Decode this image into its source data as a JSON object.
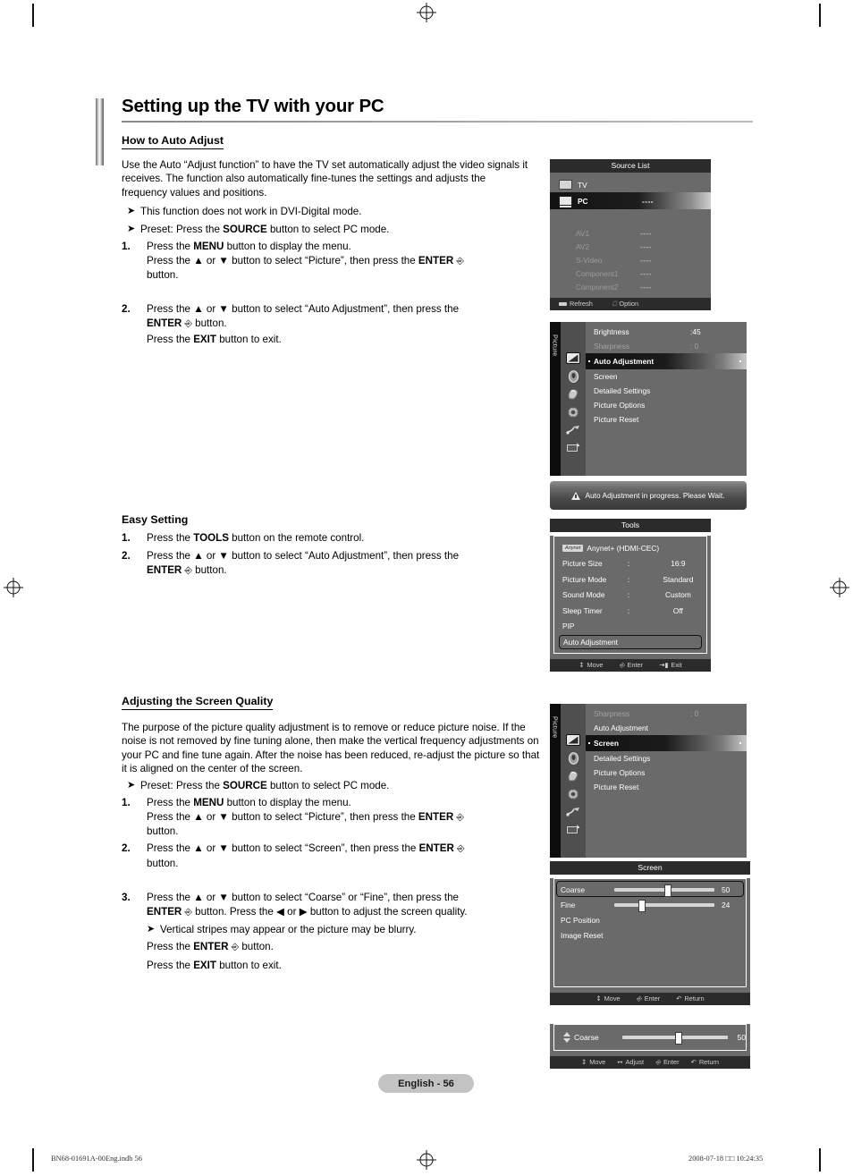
{
  "page": {
    "title": "Setting up the TV with your PC",
    "language_badge": "English - 56",
    "footer_left": "BN68-01691A-00Eng.indb   56",
    "footer_right": "2008-07-18   □□ 10:24:35"
  },
  "section_auto_adjust": {
    "heading": "How to Auto Adjust",
    "intro": "Use the Auto “Adjust function” to have the TV set automatically adjust the video signals it receives. The function also automatically fine-tunes the settings and adjusts the frequency values and positions.",
    "bullets": [
      "This function does not work in DVI-Digital mode.",
      "Preset: Press the SOURCE button to select PC mode."
    ],
    "steps": [
      {
        "num": "1.",
        "line1": "Press the MENU button to display the menu.",
        "line2": "Press the ▲ or ▼ button to select “Picture”, then press the ENTER",
        "line3": "button."
      },
      {
        "num": "2.",
        "line1": "Press the ▲ or ▼ button to select “Auto Adjustment”, then press the",
        "line2": "ENTER",
        "line3": "button.",
        "line4": "Press the EXIT button to exit."
      }
    ]
  },
  "section_easy_setting": {
    "heading": "Easy Setting",
    "steps": [
      {
        "num": "1.",
        "line1": "Press the TOOLS button on the remote control."
      },
      {
        "num": "2.",
        "line1": "Press the ▲ or ▼ button to select “Auto Adjustment”, then press the",
        "line2": "ENTER",
        "line3": "button."
      }
    ]
  },
  "section_screen_quality": {
    "heading": "Adjusting the Screen Quality",
    "intro": "The purpose of the picture quality adjustment is to remove or reduce picture noise. If the noise is not removed by fine tuning alone, then make the vertical frequency adjustments on your PC and fine tune again. After the noise has been reduced, re-adjust the picture so that it is aligned on the center of the screen.",
    "bullets": [
      "Preset: Press the SOURCE button to select PC mode."
    ],
    "steps": [
      {
        "num": "1.",
        "line1": "Press the MENU button to display the menu.",
        "line2": "Press the ▲ or ▼ button to select “Picture”, then press the ENTER",
        "line3": "button."
      },
      {
        "num": "2.",
        "line1": "Press the ▲ or ▼ button to select “Screen”, then press the ENTER",
        "line3": "button."
      },
      {
        "num": "3.",
        "line1": "Press the ▲ or ▼ button to select “Coarse” or “Fine”, then press the",
        "line2": "ENTER",
        "line2b": "button. Press the ◀ or ▶ button to adjust the screen quality.",
        "sub": "Vertical stripes may appear or the picture may be blurry.",
        "line3": "Press the ENTER",
        "line3b": "button.",
        "line4": "Press the EXIT button to exit."
      }
    ]
  },
  "osd_source_list": {
    "title": "Source List",
    "rows": [
      {
        "icon": "tv-icon",
        "name": "TV",
        "value": "",
        "state": "normal"
      },
      {
        "icon": "pc-icon",
        "name": "PC",
        "value": "----",
        "state": "selected"
      },
      {
        "icon": "",
        "name": "AV1",
        "value": "----",
        "state": "dim"
      },
      {
        "icon": "",
        "name": "AV2",
        "value": "----",
        "state": "dim"
      },
      {
        "icon": "",
        "name": "S-Video",
        "value": "----",
        "state": "dim"
      },
      {
        "icon": "",
        "name": "Component1",
        "value": "----",
        "state": "dim"
      },
      {
        "icon": "",
        "name": "Component2",
        "value": "----",
        "state": "dim"
      }
    ],
    "footer": [
      {
        "icon": "red-button-icon",
        "label": "Refresh"
      },
      {
        "icon": "tools-icon",
        "label": "Option"
      }
    ]
  },
  "osd_picture_menu_1": {
    "tab_label": "Picture",
    "rows": [
      {
        "label": "Brightness",
        "value": ":45",
        "state": "normal"
      },
      {
        "label": "Sharpness",
        "value": ": 0",
        "state": "dim"
      },
      {
        "label": "Auto Adjustment",
        "value": "",
        "state": "selected"
      },
      {
        "label": "Screen",
        "value": "",
        "state": "normal"
      },
      {
        "label": "Detailed Settings",
        "value": "",
        "state": "normal"
      },
      {
        "label": "Picture Options",
        "value": "",
        "state": "normal"
      },
      {
        "label": "Picture Reset",
        "value": "",
        "state": "normal"
      }
    ],
    "sidebar_icons": [
      "picture-icon",
      "sound-icon",
      "input-icon",
      "setup-icon",
      "network-icon",
      "support-icon"
    ]
  },
  "osd_toast": {
    "icon": "warning-icon",
    "message": "Auto Adjustment in progress. Please Wait."
  },
  "osd_tools": {
    "title": "Tools",
    "rows": [
      {
        "badge": "Anynet",
        "label": "Anynet+ (HDMI-CEC)",
        "colon": "",
        "value": ""
      },
      {
        "badge": "",
        "label": "Picture Size",
        "colon": ":",
        "value": "16:9"
      },
      {
        "badge": "",
        "label": "Picture Mode",
        "colon": ":",
        "value": "Standard"
      },
      {
        "badge": "",
        "label": "Sound Mode",
        "colon": ":",
        "value": "Custom"
      },
      {
        "badge": "",
        "label": "Sleep Timer",
        "colon": ":",
        "value": "Off"
      },
      {
        "badge": "",
        "label": "PIP",
        "colon": "",
        "value": ""
      }
    ],
    "selected_row": "Auto Adjustment",
    "footer": [
      {
        "icon": "move-icon",
        "label": "Move"
      },
      {
        "icon": "enter-icon",
        "label": "Enter"
      },
      {
        "icon": "exit-icon",
        "label": "Exit"
      }
    ]
  },
  "osd_picture_menu_2": {
    "tab_label": "Picture",
    "rows": [
      {
        "label": "Sharpness",
        "value": ": 0",
        "state": "dim"
      },
      {
        "label": "Auto Adjustment",
        "value": "",
        "state": "normal"
      },
      {
        "label": "Screen",
        "value": "",
        "state": "selected"
      },
      {
        "label": "Detailed Settings",
        "value": "",
        "state": "normal"
      },
      {
        "label": "Picture Options",
        "value": "",
        "state": "normal"
      },
      {
        "label": "Picture Reset",
        "value": "",
        "state": "normal"
      }
    ],
    "sidebar_icons": [
      "picture-icon",
      "sound-icon",
      "input-icon",
      "setup-icon",
      "network-icon",
      "support-icon"
    ]
  },
  "osd_screen": {
    "title": "Screen",
    "rows": [
      {
        "label": "Coarse",
        "value": "50",
        "slider": true,
        "percent": 50,
        "selected": true
      },
      {
        "label": "Fine",
        "value": "24",
        "slider": true,
        "percent": 24,
        "selected": false
      },
      {
        "label": "PC Position",
        "value": "",
        "slider": false,
        "percent": 0,
        "selected": false
      },
      {
        "label": "Image Reset",
        "value": "",
        "slider": false,
        "percent": 0,
        "selected": false
      }
    ],
    "footer": [
      {
        "icon": "move-icon",
        "label": "Move"
      },
      {
        "icon": "enter-icon",
        "label": "Enter"
      },
      {
        "icon": "return-icon",
        "label": "Return"
      }
    ]
  },
  "osd_coarse_bar": {
    "label": "Coarse",
    "value": "50",
    "percent": 50,
    "footer": [
      {
        "icon": "move-icon",
        "label": "Move"
      },
      {
        "icon": "adjust-icon",
        "label": "Adjust"
      },
      {
        "icon": "enter-icon",
        "label": "Enter"
      },
      {
        "icon": "return-icon",
        "label": "Return"
      }
    ]
  }
}
